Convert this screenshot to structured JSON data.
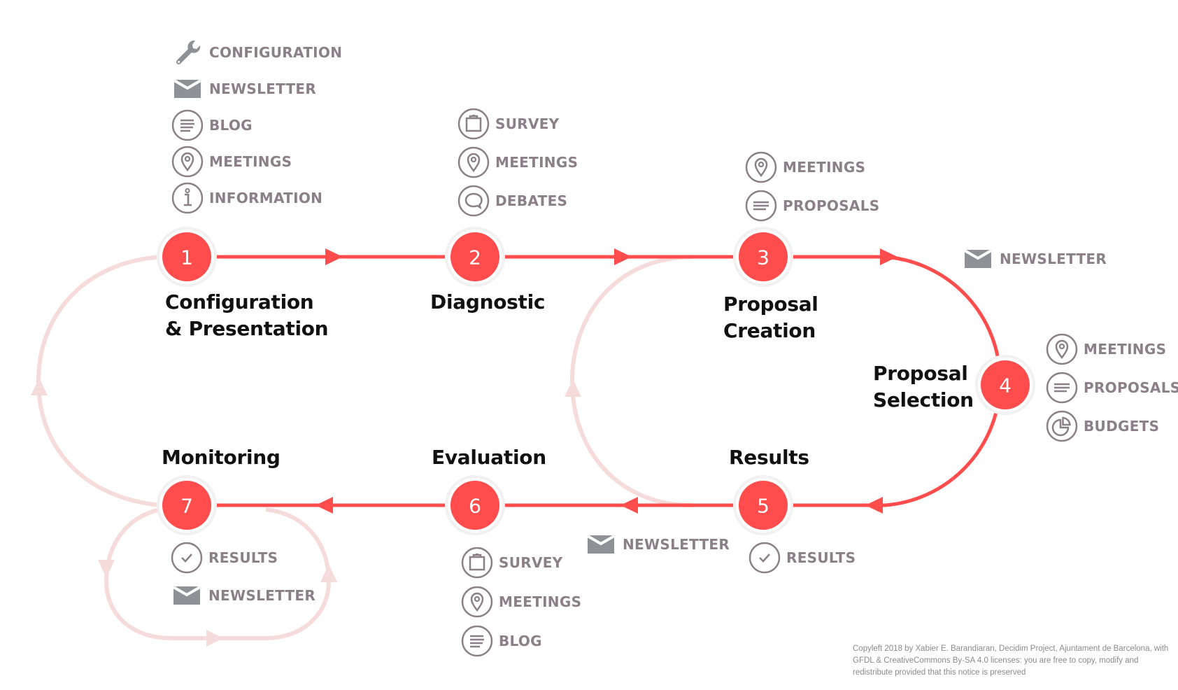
{
  "diagram": {
    "colors": {
      "active": "#ff4c4c",
      "faded": "#f5dcda",
      "node_ring": "#f1f1f1",
      "icon_stroke": "#8b8086",
      "envelope_fill": "#8e9297",
      "label_text": "#8b8086",
      "title_text": "#111111"
    },
    "stages": [
      {
        "number": "1",
        "title": "Configuration\n& Presentation",
        "tools": [
          {
            "icon": "wrench-icon",
            "label": "CONFIGURATION"
          },
          {
            "icon": "envelope-icon",
            "label": "NEWSLETTER"
          },
          {
            "icon": "blog-icon",
            "label": "BLOG"
          },
          {
            "icon": "map-pin-icon",
            "label": "MEETINGS"
          },
          {
            "icon": "info-icon",
            "label": "INFORMATION"
          }
        ]
      },
      {
        "number": "2",
        "title": "Diagnostic",
        "tools": [
          {
            "icon": "clipboard-icon",
            "label": "SURVEY"
          },
          {
            "icon": "map-pin-icon",
            "label": "MEETINGS"
          },
          {
            "icon": "speech-bubble-icon",
            "label": "DEBATES"
          }
        ]
      },
      {
        "number": "3",
        "title": "Proposal\nCreation",
        "tools": [
          {
            "icon": "map-pin-icon",
            "label": "MEETINGS"
          },
          {
            "icon": "proposals-icon",
            "label": "PROPOSALS"
          }
        ]
      },
      {
        "number": "4",
        "title": "Proposal\nSelection",
        "tools": [
          {
            "icon": "map-pin-icon",
            "label": "MEETINGS"
          },
          {
            "icon": "proposals-icon",
            "label": "PROPOSALS"
          },
          {
            "icon": "pie-chart-icon",
            "label": "BUDGETS"
          }
        ]
      },
      {
        "number": "5",
        "title": "Results",
        "tools": [
          {
            "icon": "checkmark-icon",
            "label": "RESULTS"
          }
        ]
      },
      {
        "number": "6",
        "title": "Evaluation",
        "tools": [
          {
            "icon": "clipboard-icon",
            "label": "SURVEY"
          },
          {
            "icon": "map-pin-icon",
            "label": "MEETINGS"
          },
          {
            "icon": "blog-icon",
            "label": "BLOG"
          }
        ]
      },
      {
        "number": "7",
        "title": "Monitoring",
        "tools": [
          {
            "icon": "checkmark-icon",
            "label": "RESULTS"
          },
          {
            "icon": "envelope-icon",
            "label": "NEWSLETTER"
          }
        ]
      }
    ],
    "transition_tools": [
      {
        "between": "3-4",
        "icon": "envelope-icon",
        "label": "NEWSLETTER"
      },
      {
        "between": "5-6",
        "icon": "envelope-icon",
        "label": "NEWSLETTER"
      }
    ],
    "credits": "Copyleft 2018 by Xabier E. Barandiaran, Decidim Project, Ajuntament de Barcelona, with GFDL & CreativeCommons By-SA 4.0 licenses: you are free to copy, modify and redistribute provided that this notice is preserved"
  }
}
